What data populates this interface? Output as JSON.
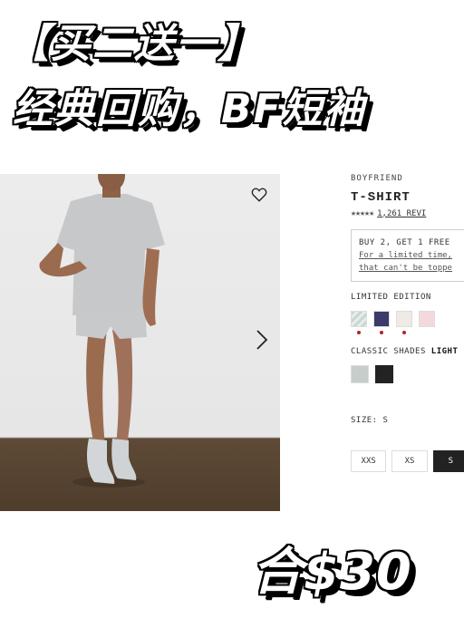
{
  "banner": {
    "line1": "【买二送一】",
    "line2": "经典回购，BF短袖"
  },
  "product": {
    "brand": "BOYFRIEND",
    "title": "T-SHIRT",
    "rating_stars": "★★★★★",
    "rating_value": 5,
    "reviews": "1,261 REVI",
    "promo_title": "BUY 2, GET 1 FREE",
    "promo_line1": "For a limited time,",
    "promo_line2": "that can't be toppe",
    "limited_label": "LIMITED EDITION",
    "limited_swatches": [
      {
        "name": "striped-sage",
        "color": "#c9d6d3",
        "dot": true
      },
      {
        "name": "navy",
        "color": "#3b3a6b",
        "dot": true
      },
      {
        "name": "cream",
        "color": "#eeebe4",
        "dot": true
      },
      {
        "name": "blush",
        "color": "#f3d9dd",
        "dot": false
      }
    ],
    "classic_label": "CLASSIC SHADES",
    "classic_selected": "LIGHT",
    "classic_swatches": [
      {
        "name": "light-heather-grey",
        "color": "#c6cdcb"
      },
      {
        "name": "black",
        "color": "#232323"
      }
    ],
    "size_label": "SIZE: S",
    "sizes": [
      "XXS",
      "XS",
      "S"
    ],
    "selected_size": "S"
  },
  "price_overlay": "合$30",
  "icons": {
    "wishlist": "heart-icon",
    "next": "chevron-right-icon",
    "rating": "star-icon"
  }
}
